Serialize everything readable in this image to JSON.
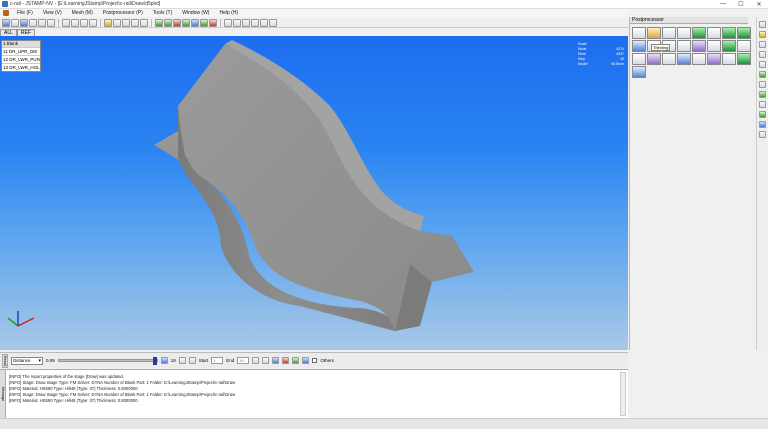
{
  "window": {
    "title": "c-rail - JSTAMP-NV - [E:\\LearningJStamp\\Project\\c-rail\\Draw\\d5plot]"
  },
  "menu": [
    {
      "label": "File (F)"
    },
    {
      "label": "View (V)"
    },
    {
      "label": "Mesh (M)"
    },
    {
      "label": "Postprocessor (P)"
    },
    {
      "label": "Tools (T)"
    },
    {
      "label": "Window (W)"
    },
    {
      "label": "Help (H)"
    }
  ],
  "tabs": [
    {
      "label": "ALL"
    },
    {
      "label": "REF"
    }
  ],
  "part_list": {
    "header": "1 Blank",
    "items": [
      {
        "label": "11 DR_UPR_DIE"
      },
      {
        "label": "12 DR_LWR_PUNCH"
      },
      {
        "label": "13 DR_LWR_HOLDER"
      }
    ]
  },
  "info_box": {
    "rows": [
      {
        "k": "Scale",
        "v": ""
      },
      {
        "k": "Node",
        "v": "4374"
      },
      {
        "k": "Elem",
        "v": "4257"
      },
      {
        "k": "Step",
        "v": "19"
      },
      {
        "k": "Model",
        "v": "50.8mm"
      }
    ]
  },
  "right_panel": {
    "title": "Postprocessor",
    "tooltip": "Thinning"
  },
  "animation": {
    "mode": "Distance",
    "value": "0.09",
    "frame": "19",
    "start_label": "Start",
    "start_value": "1",
    "end_label": "End",
    "end_value": "19",
    "others_label": "Others",
    "left_tab": "Result",
    "bottom_tab": "Message"
  },
  "messages": [
    "[INFO] The report properties of the stage [Draw] was updated.",
    "[INFO] Stage: Draw   Stage Type: FM   Solver: DYNA   Number of Blank Part: 1   Folder: E:\\LearningJStamp\\Project\\c-rail\\Draw",
    "[INFO] Material: HS590   Type: Hill48 (Type: 37)   Thickness: 0.8000000",
    "[INFO] Stage: Draw   Stage Type: FM   Solver: DYNA   Number of Blank Part: 1   Folder: E:\\LearningJStamp\\Project\\c-rail\\Draw",
    "[INFO] Material: HS590   Type: Hill48 (Type: 37)   Thickness: 0.8000000"
  ]
}
